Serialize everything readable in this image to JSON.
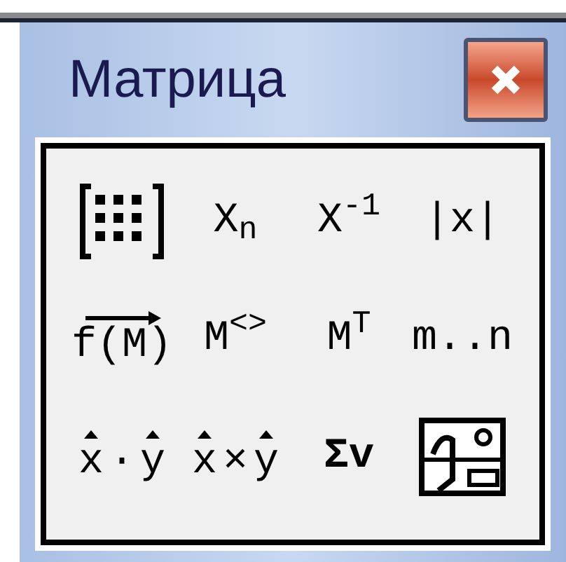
{
  "window": {
    "title": "Матрица"
  },
  "buttons": [
    {
      "kind": "matrix"
    },
    {
      "kind": "text",
      "label": "X$_{n}$"
    },
    {
      "kind": "text",
      "label": "X$^{-1}$"
    },
    {
      "kind": "text",
      "label": "|x|"
    },
    {
      "kind": "vectorize",
      "label": "f(M)"
    },
    {
      "kind": "text",
      "label": "M$^{<>}$"
    },
    {
      "kind": "text",
      "label": "M$^{T}$"
    },
    {
      "kind": "text",
      "label": "m..n"
    },
    {
      "kind": "vector-op",
      "left": "x",
      "op": "·",
      "right": "y"
    },
    {
      "kind": "vector-op",
      "left": "x",
      "op": "×",
      "right": "y"
    },
    {
      "kind": "sum",
      "label": "Σv"
    },
    {
      "kind": "picture-tool"
    }
  ]
}
